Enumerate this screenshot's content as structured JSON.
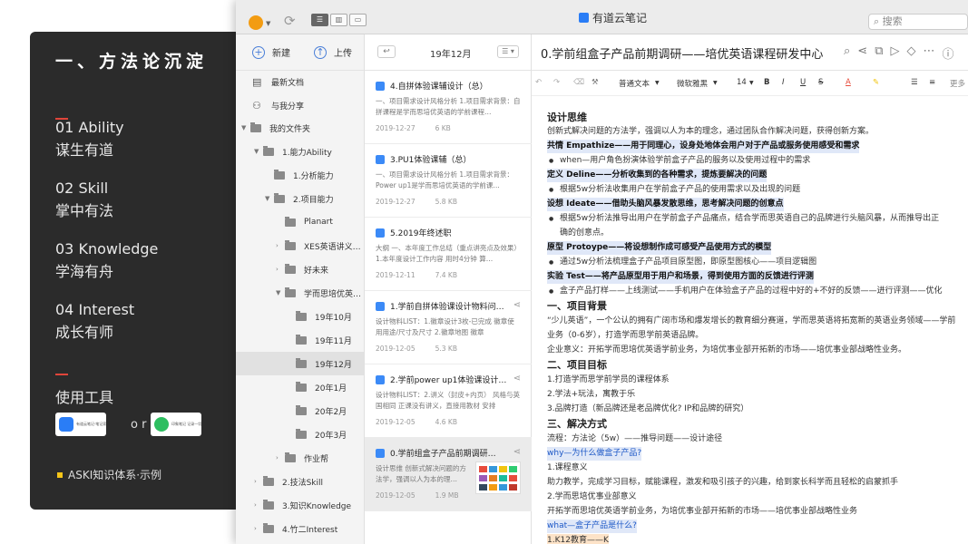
{
  "panel": {
    "title": "一、方法论沉淀",
    "sections": [
      {
        "en": "01 Ability",
        "cn": "谋生有道"
      },
      {
        "en": "02 Skill",
        "cn": "掌中有法"
      },
      {
        "en": "03 Knowledge",
        "cn": "学海有舟"
      },
      {
        "en": "04 Interest",
        "cn": "成长有师"
      }
    ],
    "tools_title": "使用工具",
    "app1": "有道云笔记·笔记家 云端·随时随地同步",
    "app2": "印象笔记 记录一切·随时随地",
    "or": "o r",
    "footer": "ASKI知识体系·示例"
  },
  "window": {
    "app_title": "有道云笔记",
    "search_placeholder": "搜索"
  },
  "sidebar": {
    "new_label": "新建",
    "upload_label": "上传",
    "items": [
      {
        "label": "最新文档"
      },
      {
        "label": "与我分享"
      },
      {
        "label": "我的文件夹"
      },
      {
        "label": "1.能力Ability"
      },
      {
        "label": "1.分析能力"
      },
      {
        "label": "2.项目能力"
      },
      {
        "label": "Planart"
      },
      {
        "label": "XES英语讲义…"
      },
      {
        "label": "好未来"
      },
      {
        "label": "学而思培优英…"
      },
      {
        "label": "19年10月"
      },
      {
        "label": "19年11月"
      },
      {
        "label": "19年12月"
      },
      {
        "label": "20年1月"
      },
      {
        "label": "20年2月"
      },
      {
        "label": "20年3月"
      },
      {
        "label": "作业帮"
      },
      {
        "label": "2.技法Skill"
      },
      {
        "label": "3.知识Knowledge"
      },
      {
        "label": "4.竹二Interest"
      }
    ]
  },
  "notelist": {
    "month": "19年12月",
    "notes": [
      {
        "title": "4.自拼体验课辅设计（总）",
        "snippet": "一、项目需求设计风格分析 1.项目需求背景：自拼课程是学而思培优英语的学前课程…",
        "date": "2019-12-27",
        "size": "6 KB"
      },
      {
        "title": "3.PU1体验课辅（总）",
        "snippet": "一、项目需求设计风格分析 1.项目需求背景：Power up1是学而思培优英语的学前课…",
        "date": "2019-12-27",
        "size": "5.8 KB"
      },
      {
        "title": "5.2019年终述职",
        "snippet": "大纲 一、本年度工作总结（重点讲亮点及效果）1.本年度设计工作内容 用时4分钟 算…",
        "date": "2019-12-11",
        "size": "7.4 KB"
      },
      {
        "title": "1.学前自拼体验课设计物料问…",
        "snippet": "设计物料LIST：1.徽章设计3枚-已完成 徽章使用用途/尺寸及尺寸 2.徽章地图 徽章",
        "date": "2019-12-05",
        "size": "5.3 KB"
      },
      {
        "title": "2.学前power up1体验课设计…",
        "snippet": "设计物料LIST：2.讲义（封皮+内页） 风格与英国相同 正课没有讲义，直接用教材 安排",
        "date": "2019-12-05",
        "size": "4.6 KB"
      },
      {
        "title": "0.学前组盒子产品前期调研…",
        "snippet": "设计思维 创新式解决问题的方法学，强调以人为本的理…",
        "date": "2019-12-05",
        "size": "1.9 MB"
      }
    ]
  },
  "editor": {
    "title": "0.学前组盒子产品前期调研——培优英语课程研发中心",
    "toolbar": {
      "style": "普通文本",
      "font": "微软雅黑",
      "size": "14",
      "more": "更多"
    },
    "lines": [
      "设计思维",
      "创新式解决问题的方法学，强调以人为本的理念，通过团队合作解决问题，获得创新方案。",
      "共情 Empathize——用于同理心，设身处地体会用户对于产品或服务使用感受和需求",
      "when—用户角色扮演体验学前盒子产品的服务以及使用过程中的需求",
      "定义 Deline——分析收集到的各种需求，提炼要解决的问题",
      "根据5w分析法收集用户在学前盒子产品的使用需求以及出现的问题",
      "设想 Ideate——借助头脑风暴发散思维，思考解决问题的创意点",
      "根据5w分析法推导出用户在学前盒子产品痛点，结合学而思英语自己的品牌进行头脑风暴，从而推导出正",
      "确的创意点。",
      "原型 Protoype——将设想制作成可感受产品使用方式的模型",
      "通过5w分析法梳理盒子产品项目原型图，即原型图核心——项目逻辑图",
      "实验 Test——将产品原型用于用户和场景，得到使用方面的反馈进行评测",
      "盒子产品打样——上线测试——手机用户在体验盒子产品的过程中好的+不好的反馈——进行评测——优化",
      "一、项目背景",
      "“少儿英语”，一个公认的拥有广阔市场和爆发增长的教育细分赛道，学而思英语将拓宽新的英语业务领域——学前",
      "业务（0-6岁），打造学而思学前英语品牌。",
      "企业意义：开拓学而思培优英语学前业务，为培优事业部开拓新的市场——培优事业部战略性业务。",
      "二、项目目标",
      "1.打造学而思学前学员的课程体系",
      "2.学法+玩法，寓教于乐",
      "3.品牌打造（新品牌还是老品牌优化? IP和品牌的研究）",
      "三、解决方式",
      "流程：方法论（5w）——推导问题——设计途径",
      "why—为什么做盒子产品?",
      "1.课程意义",
      "助力教学，完成学习目标，赋能课程，激发和吸引孩子的兴趣，给到家长科学而且轻松的启蒙抓手",
      "2.学而思培优事业部意义",
      "开拓学而思培优英语学前业务，为培优事业部开拓新的市场——培优事业部战略性业务",
      "what—盒子产品是什么?",
      "1.K12教育——K"
    ]
  },
  "colors": {
    "panel_bg": "#2b2b2b",
    "accent_red": "#e0453a",
    "brand_blue": "#2a7df6",
    "highlight": "#e0e8f8"
  }
}
